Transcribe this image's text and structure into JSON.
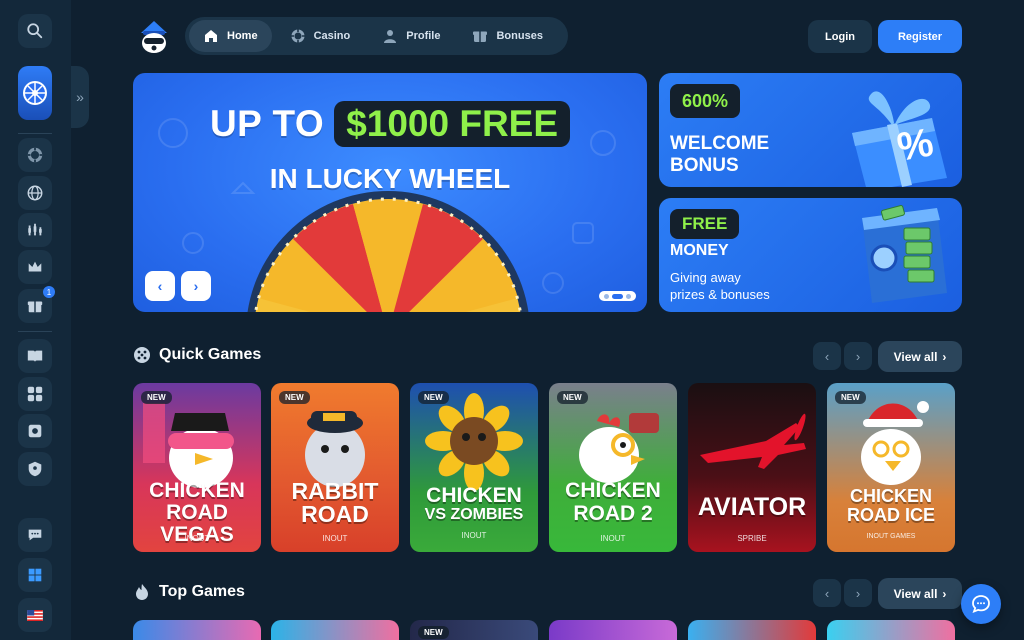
{
  "header": {
    "nav": [
      {
        "label": "Home",
        "icon": "home-icon",
        "active": true
      },
      {
        "label": "Casino",
        "icon": "casino-chip-icon",
        "active": false
      },
      {
        "label": "Profile",
        "icon": "user-icon",
        "active": false
      },
      {
        "label": "Bonuses",
        "icon": "gift-icon",
        "active": false
      }
    ],
    "login_label": "Login",
    "register_label": "Register"
  },
  "sidebar": {
    "items": [
      "search-icon",
      "lucky-wheel-icon",
      "casino-chip-icon",
      "globe-icon",
      "chart-icon",
      "crown-icon",
      "gift-icon",
      "book-icon",
      "gamepad-icon",
      "safe-icon",
      "shield-icon",
      "chat-support-icon",
      "windows-icon",
      "us-flag-icon"
    ],
    "gift_badge": "1"
  },
  "hero": {
    "line1_prefix": "UP TO",
    "line1_amount": "$1000 FREE",
    "line2": "IN LUCKY WHEEL",
    "slides": 3,
    "active_slide": 2
  },
  "promos": [
    {
      "tag": "600%",
      "title_line1": "WELCOME",
      "title_line2": "BONUS"
    },
    {
      "tag": "FREE",
      "title_line1": "MONEY",
      "subtitle_line1": "Giving away",
      "subtitle_line2": "prizes & bonuses"
    }
  ],
  "quick_games": {
    "title": "Quick Games",
    "view_all": "View all",
    "games": [
      {
        "name_line1": "CHICKEN",
        "name_line2": "ROAD VEGAS",
        "provider": "INOUT",
        "badge": "NEW"
      },
      {
        "name_line1": "RABBIT",
        "name_line2": "ROAD",
        "provider": "INOUT",
        "badge": "NEW"
      },
      {
        "name_line1": "CHICKEN",
        "name_line2": "VS ZOMBIES",
        "provider": "INOUT",
        "badge": "NEW"
      },
      {
        "name_line1": "CHICKEN",
        "name_line2": "ROAD 2",
        "provider": "INOUT",
        "badge": "NEW"
      },
      {
        "name_line1": "AVIATOR",
        "name_line2": "",
        "provider": "SPRIBE",
        "badge": ""
      },
      {
        "name_line1": "CHICKEN",
        "name_line2": "ROAD ICE",
        "provider": "INOUT GAMES",
        "badge": "NEW"
      }
    ]
  },
  "top_games": {
    "title": "Top Games",
    "view_all": "View all",
    "third_badge": "NEW"
  },
  "colors": {
    "background": "#0f2030",
    "panel": "#1b3448",
    "accent_blue": "#2d7ef7",
    "accent_green": "#8ff04a"
  }
}
